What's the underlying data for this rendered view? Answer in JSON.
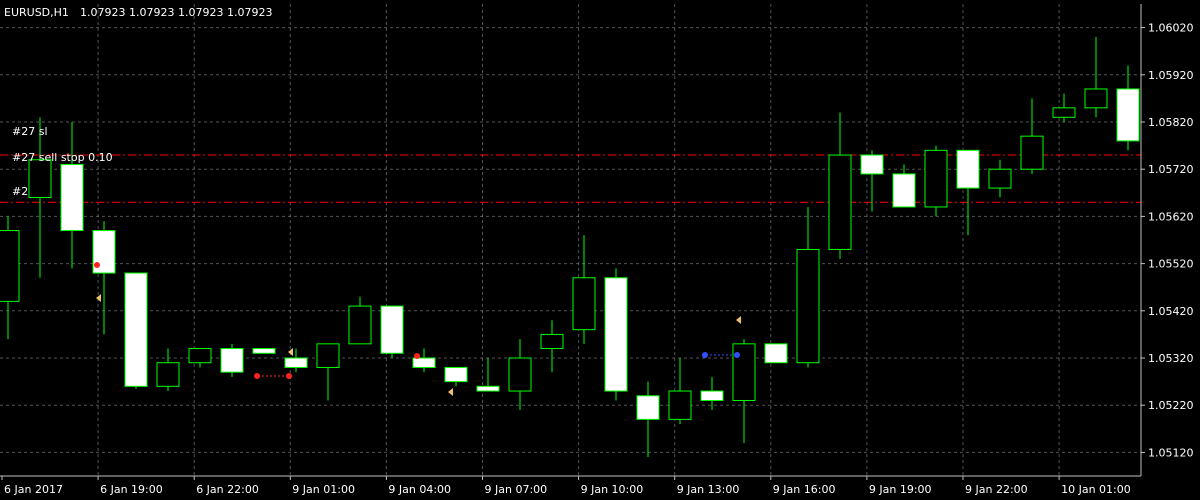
{
  "header": {
    "symbol": "EURUSD,H1",
    "ohlc": "1.07923 1.07923 1.07923 1.07923"
  },
  "order_labels": [
    "#27 sl",
    "#27 sell stop 0.10",
    "#2"
  ],
  "colors": {
    "background": "#000000",
    "grid": "#9a9a9a",
    "axis": "#c0c0c0",
    "bull_body": "#000000",
    "bear_body": "#ffffff",
    "candle_border": "#00ff00",
    "order_line": "#ff0000",
    "text": "#ffffff"
  },
  "chart_data": {
    "type": "candlestick",
    "y_range": [
      1.0507,
      1.0607
    ],
    "y_ticks": [
      "1.06020",
      "1.05920",
      "1.05820",
      "1.05720",
      "1.05620",
      "1.05520",
      "1.05420",
      "1.05320",
      "1.05220",
      "1.05120"
    ],
    "x_ticks": [
      "6 Jan 2017",
      "6 Jan 19:00",
      "6 Jan 22:00",
      "9 Jan 01:00",
      "9 Jan 04:00",
      "9 Jan 07:00",
      "9 Jan 10:00",
      "9 Jan 13:00",
      "9 Jan 16:00",
      "9 Jan 19:00",
      "9 Jan 22:00",
      "10 Jan 01:00"
    ],
    "horizontal_lines": [
      1.0575,
      1.0565
    ],
    "grid": true,
    "candles": [
      {
        "o": 1.0544,
        "h": 1.0562,
        "l": 1.0536,
        "c": 1.0559
      },
      {
        "o": 1.0566,
        "h": 1.0583,
        "l": 1.0549,
        "c": 1.0574
      },
      {
        "o": 1.0573,
        "h": 1.0582,
        "l": 1.0551,
        "c": 1.0559
      },
      {
        "o": 1.0559,
        "h": 1.0561,
        "l": 1.0537,
        "c": 1.055
      },
      {
        "o": 1.055,
        "h": 1.055,
        "l": 1.05255,
        "c": 1.0526
      },
      {
        "o": 1.0526,
        "h": 1.0534,
        "l": 1.0525,
        "c": 1.0531
      },
      {
        "o": 1.0531,
        "h": 1.0534,
        "l": 1.053,
        "c": 1.0534
      },
      {
        "o": 1.0534,
        "h": 1.0535,
        "l": 1.0528,
        "c": 1.0529
      },
      {
        "o": 1.0534,
        "h": 1.0534,
        "l": 1.0533,
        "c": 1.0533
      },
      {
        "o": 1.0532,
        "h": 1.0534,
        "l": 1.0529,
        "c": 1.053
      },
      {
        "o": 1.053,
        "h": 1.0535,
        "l": 1.0523,
        "c": 1.0535
      },
      {
        "o": 1.0535,
        "h": 1.0545,
        "l": 1.0535,
        "c": 1.0543
      },
      {
        "o": 1.0543,
        "h": 1.0543,
        "l": 1.0532,
        "c": 1.0533
      },
      {
        "o": 1.0532,
        "h": 1.0534,
        "l": 1.0529,
        "c": 1.053
      },
      {
        "o": 1.053,
        "h": 1.053,
        "l": 1.0526,
        "c": 1.0527
      },
      {
        "o": 1.0526,
        "h": 1.0532,
        "l": 1.0525,
        "c": 1.0525
      },
      {
        "o": 1.0525,
        "h": 1.0536,
        "l": 1.0521,
        "c": 1.0532
      },
      {
        "o": 1.0534,
        "h": 1.054,
        "l": 1.0529,
        "c": 1.0537
      },
      {
        "o": 1.0538,
        "h": 1.0558,
        "l": 1.0535,
        "c": 1.0549
      },
      {
        "o": 1.0549,
        "h": 1.0551,
        "l": 1.0523,
        "c": 1.0525
      },
      {
        "o": 1.0524,
        "h": 1.0527,
        "l": 1.0511,
        "c": 1.0519
      },
      {
        "o": 1.0519,
        "h": 1.0532,
        "l": 1.0518,
        "c": 1.0525
      },
      {
        "o": 1.0525,
        "h": 1.0528,
        "l": 1.0521,
        "c": 1.0523
      },
      {
        "o": 1.0523,
        "h": 1.0536,
        "l": 1.0514,
        "c": 1.0535
      },
      {
        "o": 1.0535,
        "h": 1.0535,
        "l": 1.0531,
        "c": 1.0531
      },
      {
        "o": 1.0531,
        "h": 1.0564,
        "l": 1.053,
        "c": 1.0555
      },
      {
        "o": 1.0555,
        "h": 1.0584,
        "l": 1.0553,
        "c": 1.0575
      },
      {
        "o": 1.0575,
        "h": 1.0576,
        "l": 1.0563,
        "c": 1.0571
      },
      {
        "o": 1.0571,
        "h": 1.0573,
        "l": 1.0564,
        "c": 1.0564
      },
      {
        "o": 1.0564,
        "h": 1.0577,
        "l": 1.0562,
        "c": 1.0576
      },
      {
        "o": 1.0576,
        "h": 1.0576,
        "l": 1.0558,
        "c": 1.0568
      },
      {
        "o": 1.0568,
        "h": 1.0574,
        "l": 1.0566,
        "c": 1.0572
      },
      {
        "o": 1.0572,
        "h": 1.0587,
        "l": 1.0571,
        "c": 1.0579
      },
      {
        "o": 1.0583,
        "h": 1.0588,
        "l": 1.0582,
        "c": 1.0585
      },
      {
        "o": 1.0585,
        "h": 1.06,
        "l": 1.0583,
        "c": 1.0589
      },
      {
        "o": 1.0589,
        "h": 1.0594,
        "l": 1.0576,
        "c": 1.0578
      }
    ]
  }
}
